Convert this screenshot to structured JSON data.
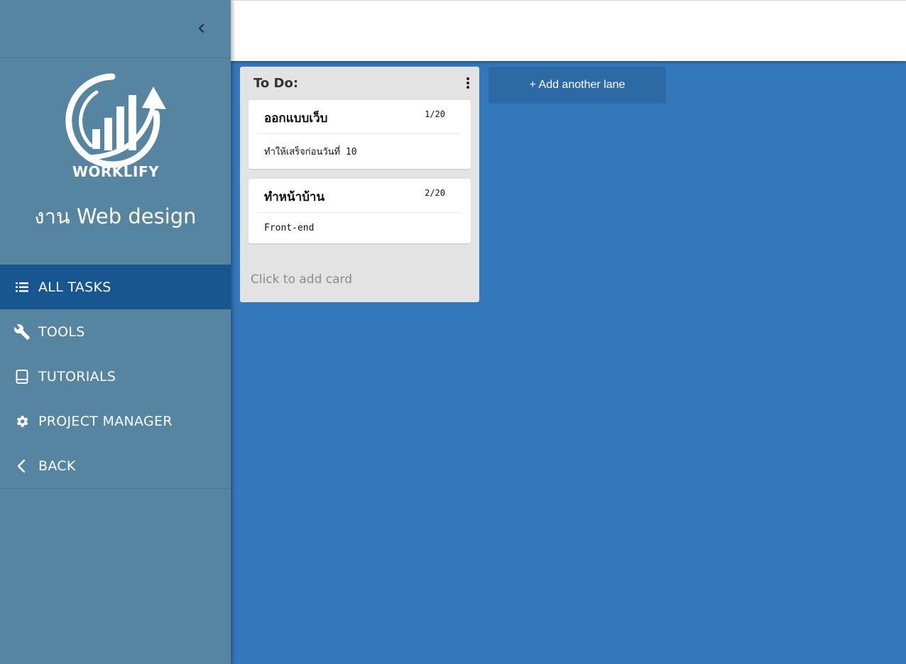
{
  "sidebar": {
    "logo_text": "WORKLIFY",
    "project_title": "งาน Web design",
    "nav_items": [
      {
        "label": "ALL TASKS",
        "icon": "list-icon",
        "active": true
      },
      {
        "label": "TOOLS",
        "icon": "wrench-icon",
        "active": false
      },
      {
        "label": "TUTORIALS",
        "icon": "book-icon",
        "active": false
      },
      {
        "label": "PROJECT MANAGER",
        "icon": "gear-icon",
        "active": false
      },
      {
        "label": "BACK",
        "icon": "chevron-left-icon",
        "active": false
      }
    ]
  },
  "board": {
    "lanes": [
      {
        "title": "To Do:",
        "cards": [
          {
            "title": "ออกแบบเว็บ",
            "label": "1/20",
            "description": "ทำให้เสร็จก่อนวันที่ 10"
          },
          {
            "title": "ทำหน้าบ้าน",
            "label": "2/20",
            "description": "Front-end"
          }
        ],
        "add_card_text": "Click to add card"
      }
    ],
    "add_lane_text": "+ Add another lane"
  },
  "colors": {
    "board_background": "#3478bc",
    "sidebar_background": "#5585a0",
    "sidebar_active": "#17568f",
    "lane_background": "#e3e3e3",
    "add_lane_button": "#2d6aa5"
  }
}
